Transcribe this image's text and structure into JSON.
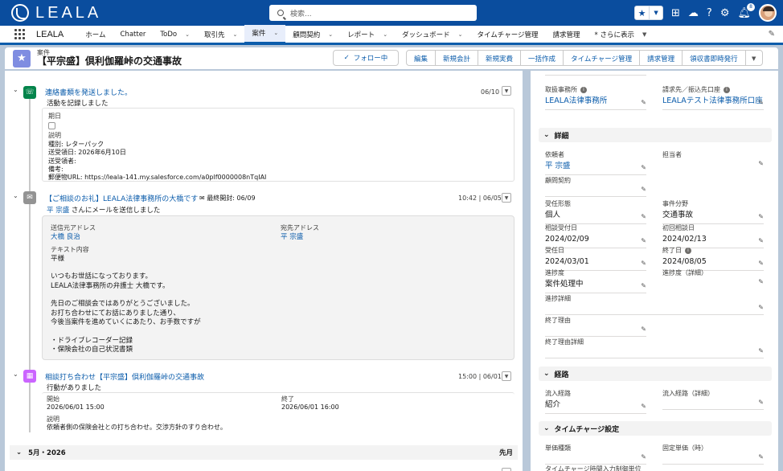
{
  "app": {
    "logo": "LEALA",
    "name": "LEALA"
  },
  "search": {
    "placeholder": "検索..."
  },
  "top_icons": {
    "notifications_count": "8"
  },
  "nav": {
    "items": [
      "ホーム",
      "Chatter",
      "ToDo",
      "取引先",
      "案件",
      "顧問契約",
      "レポート",
      "ダッシュボード",
      "タイムチャージ管理",
      "請求管理",
      "* さらに表示"
    ],
    "active": "案件"
  },
  "record": {
    "object_label": "案件",
    "title": "【平宗盛】倶利伽羅峠の交通事故",
    "follow_label": "フォロー中",
    "actions": [
      "編集",
      "新規会計",
      "新規実費",
      "一括作成",
      "タイムチャージ管理",
      "請求管理",
      "領収書即時発行"
    ]
  },
  "timeline": [
    {
      "type": "task",
      "title": "連絡書類を発送しました。",
      "date": "06/10",
      "subtitle": "活動を記録しました",
      "detail": {
        "due_label": "期日",
        "desc_label": "説明",
        "lines": [
          "種別: レターパック",
          "送受領日: 2026年6月10日",
          "送受領者:",
          "備考:",
          "郵便物URL: https://leala-141.my.salesforce.com/a0plf0000008nTqIAI"
        ]
      }
    },
    {
      "type": "email",
      "title": "【ご相談のお礼】LEALA法律事務所の大橋です",
      "last_opened": "最終開封: 06/09",
      "date": "10:42 | 06/05",
      "sender": "平 宗盛",
      "subtitle_rest": "さんにメールを送信しました",
      "from_label": "送信元アドレス",
      "from_value": "大橋 良治",
      "to_label": "宛先アドレス",
      "to_value": "平 宗盛",
      "body_label": "テキスト内容",
      "body": [
        "平様",
        "",
        "いつもお世話になっております。",
        "LEALA法律事務所の弁護士 大橋です。",
        "",
        "先日のご相談会ではありがとうございました。",
        "お打ち合わせにてお話にありました通り、",
        "今後当案件を進めていくにあたり、お手数ですが",
        "",
        "・ドライブレコーダー記録",
        "・保険会社の自己状況書類"
      ]
    },
    {
      "type": "event",
      "title": "相談打ち合わせ【平宗盛】倶利伽羅峠の交通事故",
      "date": "15:00 | 06/01",
      "subtitle": "行動がありました",
      "start_label": "開始",
      "start_value": "2026/06/01 15:00",
      "end_label": "終了",
      "end_value": "2026/06/01 16:00",
      "desc_label": "説明",
      "desc_value": "依頼者側の保険会社との打ち合わせ。交渉方針のすり合わせ。"
    }
  ],
  "month_bar": {
    "label": "5月・2026",
    "right": "先月"
  },
  "details": {
    "top_fields": [
      {
        "label": "取扱事務所",
        "value": "LEALA法律事務所",
        "link": true,
        "info": true
      },
      {
        "label": "請求先／振込先口座",
        "value": "LEALAテスト法律事務所口座",
        "link": true,
        "info": true
      }
    ],
    "section_detail": "詳細",
    "fields": [
      {
        "label": "依頼者",
        "value": "平 宗盛",
        "link": true
      },
      {
        "label": "担当者",
        "value": ""
      },
      {
        "label": "顧問契約",
        "value": ""
      },
      {
        "label": "受任形態",
        "value": "個人"
      },
      {
        "label": "事件分野",
        "value": "交通事故"
      },
      {
        "label": "相談受付日",
        "value": "2024/02/09"
      },
      {
        "label": "初回相談日",
        "value": "2024/02/13"
      },
      {
        "label": "受任日",
        "value": "2024/03/01"
      },
      {
        "label": "終了日",
        "value": "2024/08/05",
        "info": true
      },
      {
        "label": "進捗度",
        "value": "案件処理中"
      },
      {
        "label": "進捗度（詳細）",
        "value": ""
      },
      {
        "label": "進捗詳細",
        "value": ""
      },
      {
        "label": "終了理由",
        "value": ""
      },
      {
        "label": "終了理由詳細",
        "value": ""
      }
    ],
    "section_route": "経路",
    "route_fields": [
      {
        "label": "流入経路",
        "value": "紹介"
      },
      {
        "label": "流入経路（詳細）",
        "value": ""
      }
    ],
    "section_timecharge": "タイムチャージ設定",
    "tc_fields": [
      {
        "label": "単価種類",
        "value": ""
      },
      {
        "label": "固定単価（時）",
        "value": ""
      },
      {
        "label": "タイムチャージ時間入力制御単位",
        "value": ""
      }
    ]
  },
  "colors": {
    "brand": "#0a4d9e",
    "link": "#0b5cab",
    "task": "#04844b",
    "email": "#939393",
    "event": "#cb65ff",
    "record_icon": "#7f8de1"
  }
}
